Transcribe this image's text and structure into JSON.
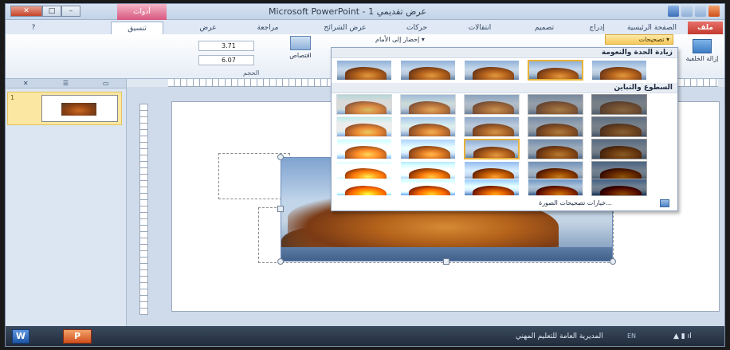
{
  "titlebar": {
    "app_title": "Microsoft PowerPoint - عرض تقديمي 1",
    "context_tab": "أدوات"
  },
  "tabs": [
    {
      "label": "ملف"
    },
    {
      "label": "الصفحة الرئيسية"
    },
    {
      "label": "إدراج"
    },
    {
      "label": "تصميم"
    },
    {
      "label": "انتقالات"
    },
    {
      "label": "حركات"
    },
    {
      "label": "عرض الشرائح"
    },
    {
      "label": "مراجعة"
    },
    {
      "label": "عرض"
    },
    {
      "label": "تنسيق"
    }
  ],
  "ribbon": {
    "corrections": "تصحيحات",
    "remove_background": "إزالة الخلفية",
    "bring_forward": "إحضار إلى الأمام",
    "crop": "اقتصاص",
    "size_group": "الحجم",
    "height_value": "3.71",
    "width_value": "6.07"
  },
  "gallery": {
    "section_sharpen": "زيادة الحدة والنعومة",
    "section_brightness": "السطوع والتباين",
    "more_options": "خيارات تصحيحات الصورة..."
  },
  "left_pane": {
    "slide_number": "1"
  },
  "statusbar": {
    "text": "المديرية العامة للتعليم المهني",
    "lang": "EN",
    "word_label": "W",
    "ppt_label": "P"
  }
}
